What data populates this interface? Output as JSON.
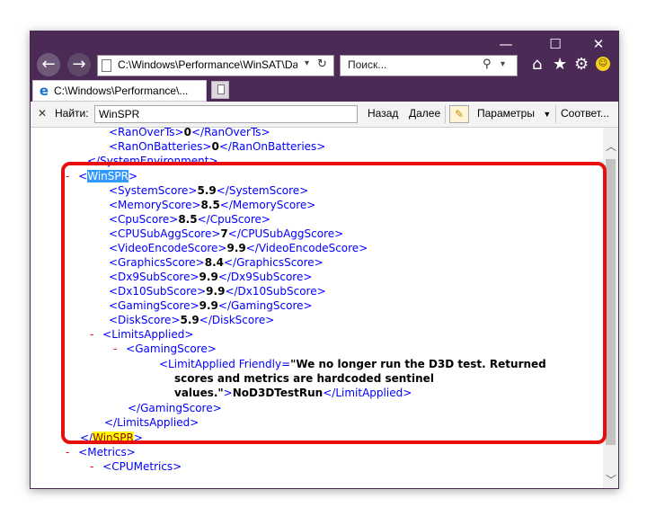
{
  "window": {
    "controls": [
      "—",
      "☐",
      "✕"
    ]
  },
  "nav": {
    "back": "⮌",
    "forward": "➜"
  },
  "address": {
    "url": "C:\\Windows\\Performance\\WinSAT\\Da",
    "dropdown": "▾",
    "refresh": "↻"
  },
  "search": {
    "placeholder": "Поиск...",
    "icon": "⚲",
    "dropdown": "▾"
  },
  "toolbar_icons": {
    "home": "⌂",
    "favorites": "★",
    "settings": "⚙",
    "smiley": "☺"
  },
  "tab": {
    "label": "C:\\Windows\\Performance\\...",
    "icon": "e"
  },
  "findbar": {
    "close": "✕",
    "label": "Найти:",
    "query": "WinSPR",
    "prev": "Назад",
    "next": "Далее",
    "pen": "✎",
    "options": "Параметры",
    "options_arrow": "▼",
    "matches": "Соответ..."
  },
  "xml": {
    "ranovert_open": "<RanOverTs>",
    "ranovert_val": "0",
    "ranovert_close": "</RanOverTs>",
    "ranonbat_open": "<RanOnBatteries>",
    "ranonbat_val": "0",
    "ranonbat_close": "</RanOnBatteries>",
    "sysenv_close": "</SystemEnvironment>",
    "dash": "-",
    "winspr_lt": "<",
    "winspr_name": "WinSPR",
    "winspr_gt": ">",
    "scores": [
      {
        "open": "<SystemScore>",
        "val": "5.9",
        "close": "</SystemScore>"
      },
      {
        "open": "<MemoryScore>",
        "val": "8.5",
        "close": "</MemoryScore>"
      },
      {
        "open": "<CpuScore>",
        "val": "8.5",
        "close": "</CpuScore>"
      },
      {
        "open": "<CPUSubAggScore>",
        "val": "7",
        "close": "</CPUSubAggScore>"
      },
      {
        "open": "<VideoEncodeScore>",
        "val": "9.9",
        "close": "</VideoEncodeScore>"
      },
      {
        "open": "<GraphicsScore>",
        "val": "8.4",
        "close": "</GraphicsScore>"
      },
      {
        "open": "<Dx9SubScore>",
        "val": "9.9",
        "close": "</Dx9SubScore>"
      },
      {
        "open": "<Dx10SubScore>",
        "val": "9.9",
        "close": "</Dx10SubScore>"
      },
      {
        "open": "<GamingScore>",
        "val": "9.9",
        "close": "</GamingScore>"
      },
      {
        "open": "<DiskScore>",
        "val": "5.9",
        "close": "</DiskScore>"
      }
    ],
    "limits_open": "<LimitsApplied>",
    "gaming_open": "<GamingScore>",
    "limit_tag_open": "<LimitApplied Friendly=",
    "limit_text_1": "\"We no longer run the D3D test. Returned",
    "limit_text_2": "scores and metrics are hardcoded sentinel",
    "limit_text_3": "values.\"",
    "limit_gt": ">",
    "limit_val": "NoD3DTestRun",
    "limit_close": "</LimitApplied>",
    "gaming_close": "</GamingScore>",
    "limits_close": "</LimitsApplied>",
    "winspr_close_lt": "</",
    "metrics_open": "<Metrics>",
    "cpumetrics_open": "<CPUMetrics>"
  },
  "scrollbar": {
    "up": "︿",
    "down": "﹀"
  },
  "colors": {
    "titlebar": "#4b2b55",
    "tag_name": "#990000",
    "bracket": "#0000ff",
    "highlight_selected": "#3399ff",
    "highlight_match": "#ffff00",
    "annotation": "#e80e0e"
  }
}
